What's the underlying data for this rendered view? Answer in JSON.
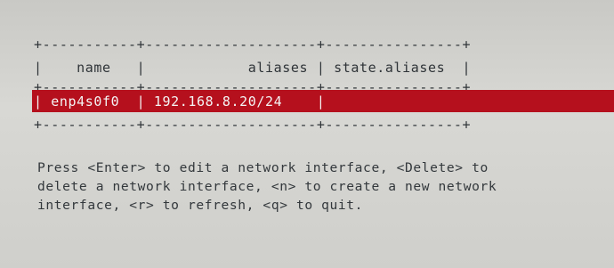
{
  "table": {
    "border_top": "+-----------+--------------------+----------------+",
    "border_header": "+-----------+--------------------+----------------+",
    "border_bottom": "+-----------+--------------------+----------------+",
    "header_line": "|    name   |            aliases | state.aliases  |",
    "columns": [
      "name",
      "aliases",
      "state.aliases"
    ],
    "rows": [
      {
        "line": "| enp4s0f0  | 192.168.8.20/24    |",
        "name": "enp4s0f0",
        "aliases": "192.168.8.20/24",
        "state_aliases": ""
      }
    ]
  },
  "help": {
    "line1": "Press <Enter> to edit a network interface, <Delete> to",
    "line2": "delete a network interface, <n> to create a new network",
    "line3": "interface, <r> to refresh, <q> to quit."
  },
  "colors": {
    "background": "#d4d4d0",
    "highlight": "#b5101d",
    "text": "#2f3438",
    "highlight_text": "#f4f4f4"
  }
}
